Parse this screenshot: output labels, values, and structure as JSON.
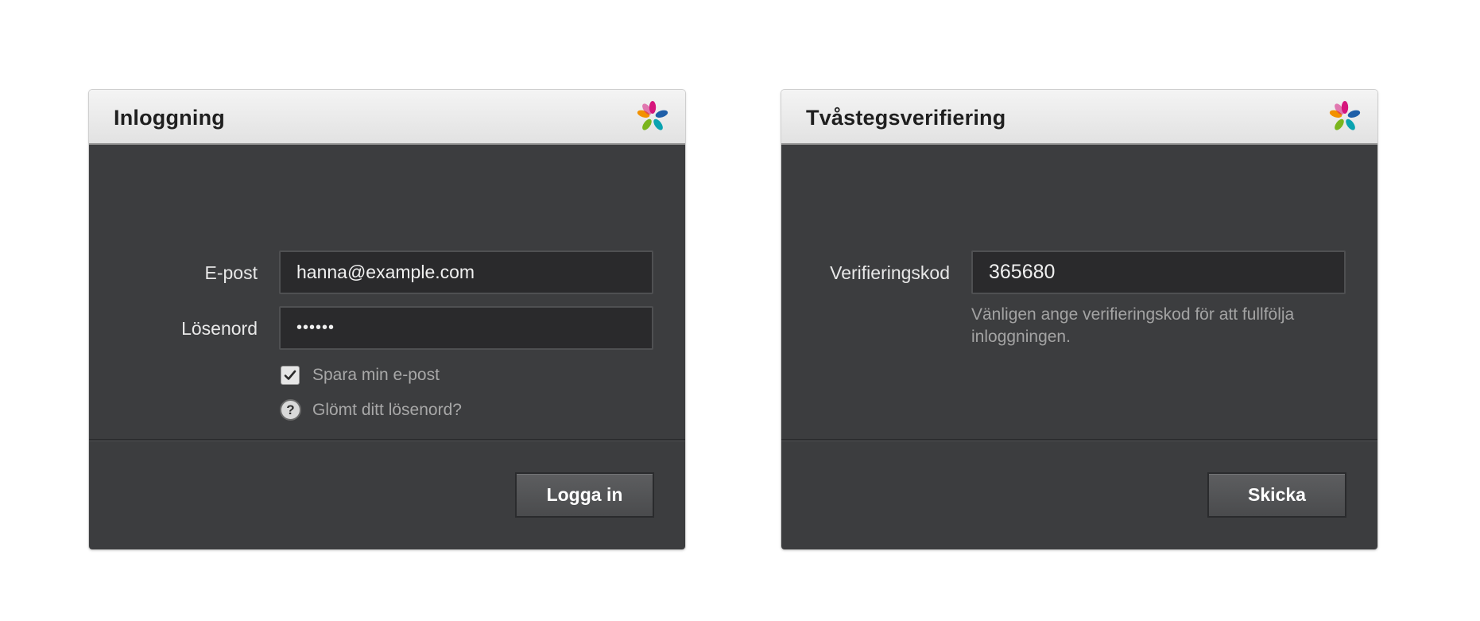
{
  "login": {
    "title": "Inloggning",
    "email_label": "E-post",
    "email_value": "hanna@example.com",
    "password_label": "Lösenord",
    "password_value": "••••••",
    "remember_label": "Spara min e-post",
    "remember_checked": true,
    "forgot_label": "Glömt ditt lösenord?",
    "help_glyph": "?",
    "submit_label": "Logga in"
  },
  "verify": {
    "title": "Tvåstegsverifiering",
    "code_label": "Verifieringskod",
    "code_value": "365680",
    "hint": "Vänligen ange verifieringskod för att fullfölja inloggningen.",
    "submit_label": "Skicka"
  },
  "icons": {
    "logo": "flower-logo-icon",
    "check": "checkmark-icon",
    "help": "question-icon"
  },
  "colors": {
    "panel_bg": "#3c3d3f",
    "header_bg": "#e8e8e8",
    "input_bg": "#2a2a2c",
    "logo_magenta": "#d6157c",
    "logo_blue": "#1f5fa8",
    "logo_teal": "#0aa3b0",
    "logo_green": "#7ab51d",
    "logo_orange": "#f29100"
  }
}
